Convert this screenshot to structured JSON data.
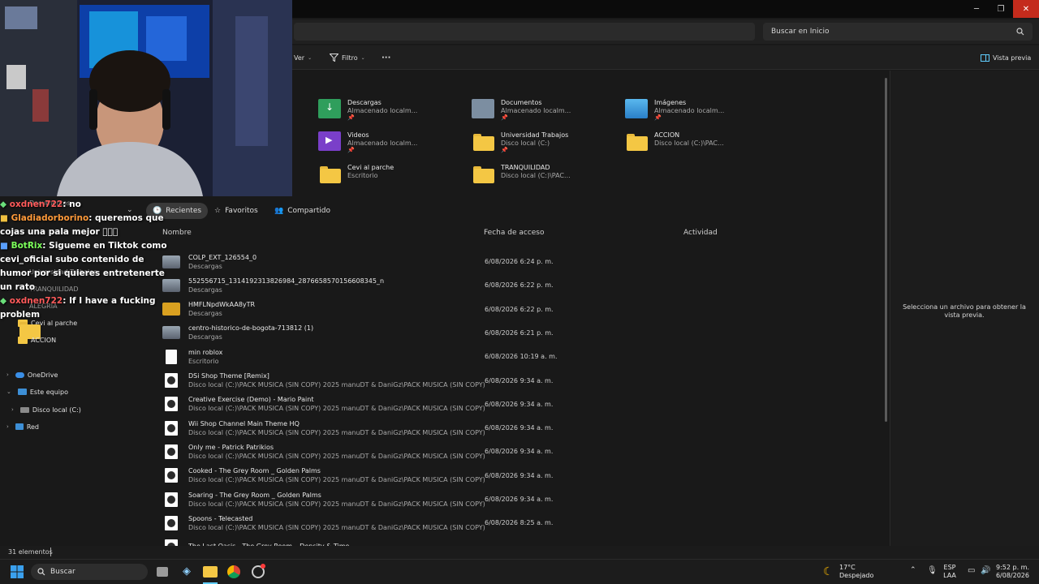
{
  "window": {
    "minimize_icon": "minimize-icon",
    "maximize_icon": "restore-icon",
    "close_icon": "close-icon"
  },
  "search": {
    "placeholder": "Buscar en Inicio"
  },
  "toolbar": {
    "ver_label": "Ver",
    "filtro_label": "Filtro",
    "more_label": "···",
    "preview_label": "Vista previa"
  },
  "quick_access": [
    {
      "name": "Descargas",
      "sub": "Almacenado localm...",
      "icon": "download-folder-icon"
    },
    {
      "name": "Documentos",
      "sub": "Almacenado localm...",
      "icon": "documents-folder-icon"
    },
    {
      "name": "Imágenes",
      "sub": "Almacenado localm...",
      "icon": "pictures-folder-icon"
    },
    {
      "name": "Videos",
      "sub": "Almacenado localm...",
      "icon": "videos-folder-icon"
    },
    {
      "name": "Universidad Trabajos",
      "sub": "Disco local (C:)",
      "icon": "folder-icon"
    },
    {
      "name": "ACCION",
      "sub": "Disco local (C:)\\PAC...",
      "icon": "folder-icon"
    },
    {
      "name": "Cevi al parche",
      "sub": "Escritorio",
      "icon": "folder-icon"
    },
    {
      "name": "TRANQUILIDAD",
      "sub": "Disco local (C:)\\PAC...",
      "icon": "folder-icon"
    }
  ],
  "tabs": {
    "recientes": "Recientes",
    "favoritos": "Favoritos",
    "compartido": "Compartido"
  },
  "columns": {
    "nombre": "Nombre",
    "fecha": "Fecha de acceso",
    "actividad": "Actividad"
  },
  "files": [
    {
      "name": "COLP_EXT_126554_0",
      "loc": "Descargas",
      "date": "6/08/2026 6:24 p. m.",
      "type": "image"
    },
    {
      "name": "552556715_1314192313826984_2876658570156608345_n",
      "loc": "Descargas",
      "date": "6/08/2026 6:22 p. m.",
      "type": "image"
    },
    {
      "name": "HMFLNpdWkAA8yTR",
      "loc": "Descargas",
      "date": "6/08/2026 6:22 p. m.",
      "type": "image2"
    },
    {
      "name": "centro-historico-de-bogota-713812 (1)",
      "loc": "Descargas",
      "date": "6/08/2026 6:21 p. m.",
      "type": "image"
    },
    {
      "name": "min roblox",
      "loc": "Escritorio",
      "date": "6/08/2026 10:19 a. m.",
      "type": "doc"
    },
    {
      "name": "DSi Shop Theme [Remix]",
      "loc": "Disco local (C:)\\PACK MUSICA (SIN COPY) 2025 manuDT & DaniGz\\PACK MUSICA (SIN COPY) m...",
      "date": "6/08/2026 9:34 a. m.",
      "type": "audio"
    },
    {
      "name": "Creative Exercise (Demo) - Mario Paint",
      "loc": "Disco local (C:)\\PACK MUSICA (SIN COPY) 2025 manuDT & DaniGz\\PACK MUSICA (SIN COPY) m...",
      "date": "6/08/2026 9:34 a. m.",
      "type": "audio"
    },
    {
      "name": "Wii Shop Channel Main Theme HQ",
      "loc": "Disco local (C:)\\PACK MUSICA (SIN COPY) 2025 manuDT & DaniGz\\PACK MUSICA (SIN COPY) m...",
      "date": "6/08/2026 9:34 a. m.",
      "type": "audio"
    },
    {
      "name": "Only me - Patrick Patrikios",
      "loc": "Disco local (C:)\\PACK MUSICA (SIN COPY) 2025 manuDT & DaniGz\\PACK MUSICA (SIN COPY) m...",
      "date": "6/08/2026 9:34 a. m.",
      "type": "audio"
    },
    {
      "name": "Cooked - The Grey Room _ Golden Palms",
      "loc": "Disco local (C:)\\PACK MUSICA (SIN COPY) 2025 manuDT & DaniGz\\PACK MUSICA (SIN COPY) m...",
      "date": "6/08/2026 9:34 a. m.",
      "type": "audio"
    },
    {
      "name": "Soaring - The Grey Room _ Golden Palms",
      "loc": "Disco local (C:)\\PACK MUSICA (SIN COPY) 2025 manuDT & DaniGz\\PACK MUSICA (SIN COPY) m...",
      "date": "6/08/2026 9:34 a. m.",
      "type": "audio"
    },
    {
      "name": "Spoons - Telecasted",
      "loc": "Disco local (C:)\\PACK MUSICA (SIN COPY) 2025 manuDT & DaniGz\\PACK MUSICA (SIN COPY) m...",
      "date": "6/08/2026 8:25 a. m.",
      "type": "audio"
    },
    {
      "name": "The Last Oasis - The Grey Room _ Density & Time",
      "loc": "",
      "date": "",
      "type": "audio"
    }
  ],
  "preview_message": "Selecciona un archivo para obtener la vista previa.",
  "sidebar": {
    "items": [
      {
        "label": "Documentos"
      },
      {
        "label": "Universidad Trabajos"
      },
      {
        "label": "TRANQUILIDAD"
      },
      {
        "label": "ALEGRIA"
      },
      {
        "label": "Cevi al parche"
      },
      {
        "label": "ACCION"
      },
      {
        "label": "OneDrive"
      },
      {
        "label": "Este equipo"
      },
      {
        "label": "Disco local (C:)"
      },
      {
        "label": "Red"
      }
    ]
  },
  "chat": [
    {
      "user": "oxdnen722",
      "message": ": no"
    },
    {
      "user": "Gladiadorborino",
      "message": ": queremos que cojas una pala mejor 🏻🏻🏻"
    },
    {
      "user": "BotRix",
      "message": ": Sigueme en Tiktok como cevi_oficial subo contenido de humor por si quieres entretenerte un rato"
    },
    {
      "user": "oxdnen722",
      "message": ": If I have a fucking problem"
    }
  ],
  "status": {
    "count": "31 elementos"
  },
  "taskbar": {
    "search_label": "Buscar",
    "weather_temp": "17°C",
    "weather_desc": "Despejado",
    "lang1": "ESP",
    "lang2": "LAA",
    "time": "9:52 p. m.",
    "date": "6/08/2026"
  },
  "colors": {
    "accent": "#60cdff",
    "close": "#c42b1c",
    "folder": "#f4c744"
  }
}
